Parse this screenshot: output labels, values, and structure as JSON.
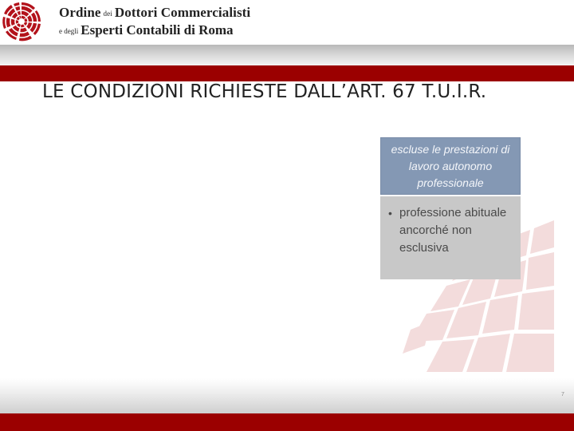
{
  "header": {
    "org_line1_main": "Ordine",
    "org_line1_small": "dei",
    "org_line1_rest": "Dottori Commercialisti",
    "org_line2_small": "e degli",
    "org_line2_rest": "Esperti Contabili di Roma"
  },
  "slide": {
    "title": "LE CONDIZIONI RICHIESTE DALL’ART. 67 T.U.I.R.",
    "box_header": "escluse le prestazioni di lavoro autonomo professionale",
    "bullet_symbol": "•",
    "bullets": [
      "professione abituale ancorché non esclusiva"
    ],
    "page_mark": "7"
  },
  "colors": {
    "brand_red": "#9b0000",
    "box_header_bg": "#8498b4",
    "box_body_bg": "#c8c8c8"
  }
}
